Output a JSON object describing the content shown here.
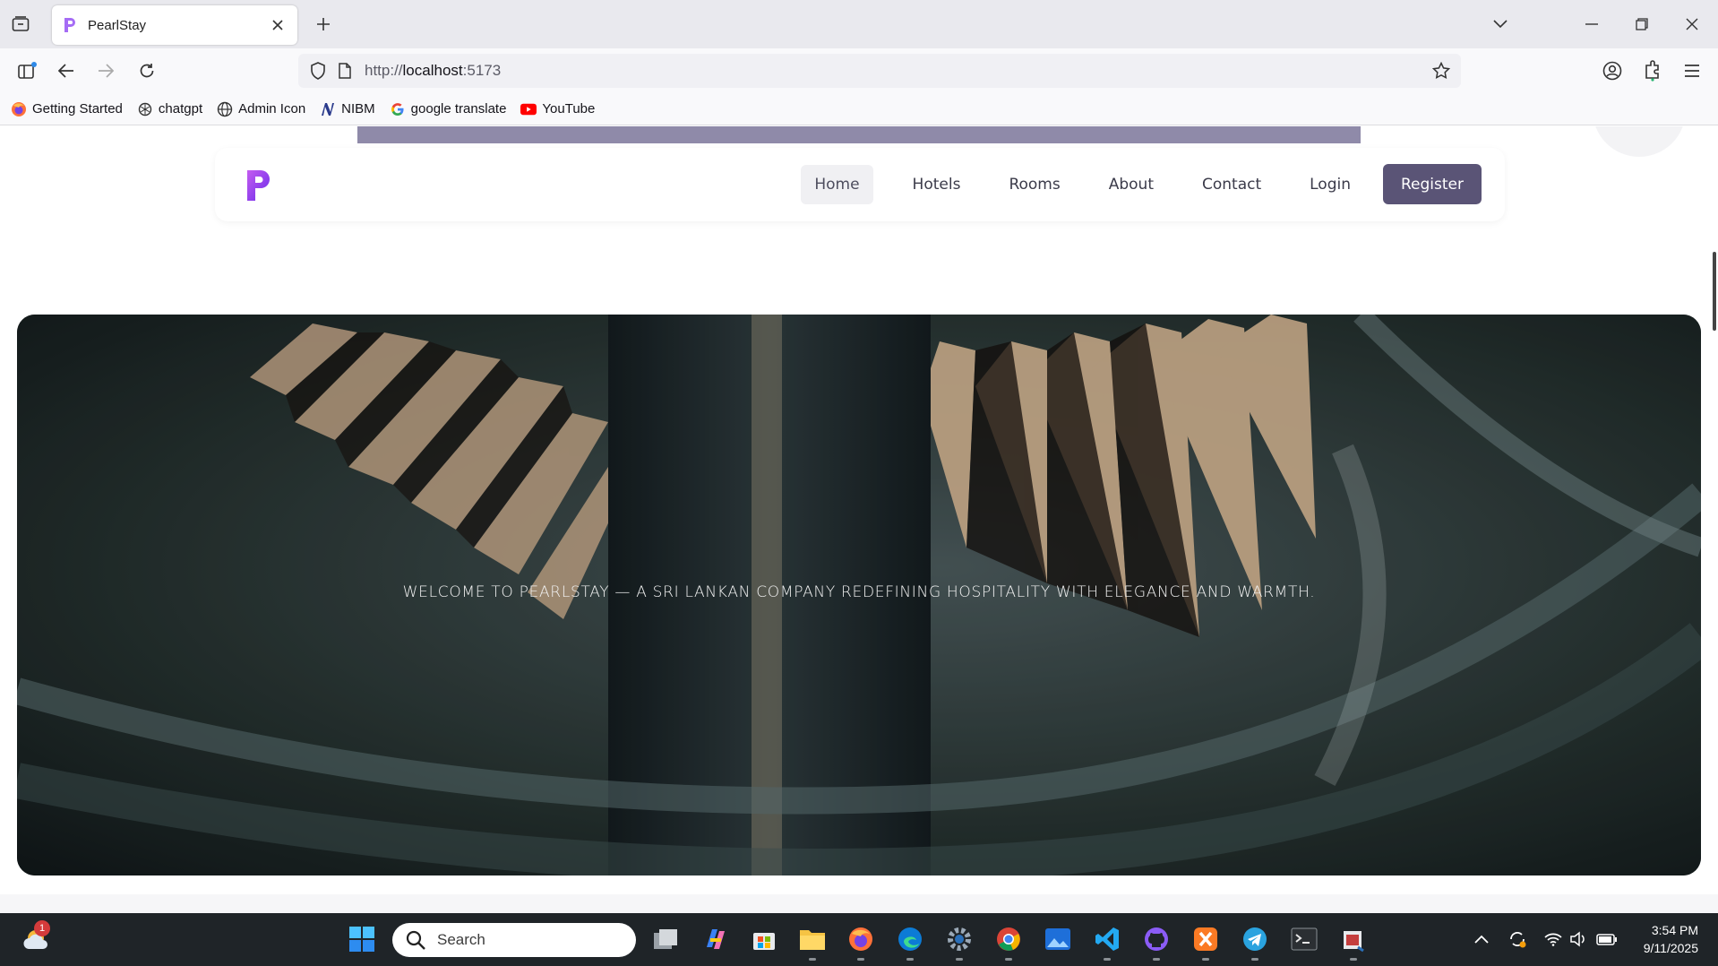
{
  "browser": {
    "tab_title": "PearlStay",
    "url_prefix": "http://",
    "url_host": "localhost",
    "url_suffix": ":5173",
    "bookmarks": [
      {
        "label": "Getting Started",
        "icon": "firefox-icon"
      },
      {
        "label": "chatgpt",
        "icon": "chatgpt-icon"
      },
      {
        "label": "Admin Icon",
        "icon": "globe-icon"
      },
      {
        "label": "NIBM",
        "icon": "nibm-icon"
      },
      {
        "label": "google translate",
        "icon": "google-icon"
      },
      {
        "label": "YouTube",
        "icon": "youtube-icon"
      }
    ]
  },
  "site": {
    "nav": {
      "home": "Home",
      "hotels": "Hotels",
      "rooms": "Rooms",
      "about": "About",
      "contact": "Contact",
      "login": "Login",
      "register": "Register"
    },
    "hero_text": "Welcome to PearlStay — a Sri Lankan company redefining hospitality with elegance and warmth.",
    "colors": {
      "brand": "#8a3cf0",
      "button": "#5a5476"
    }
  },
  "taskbar": {
    "search_placeholder": "Search",
    "weather_badge": "1",
    "time": "3:54 PM",
    "date": "9/11/2025"
  }
}
